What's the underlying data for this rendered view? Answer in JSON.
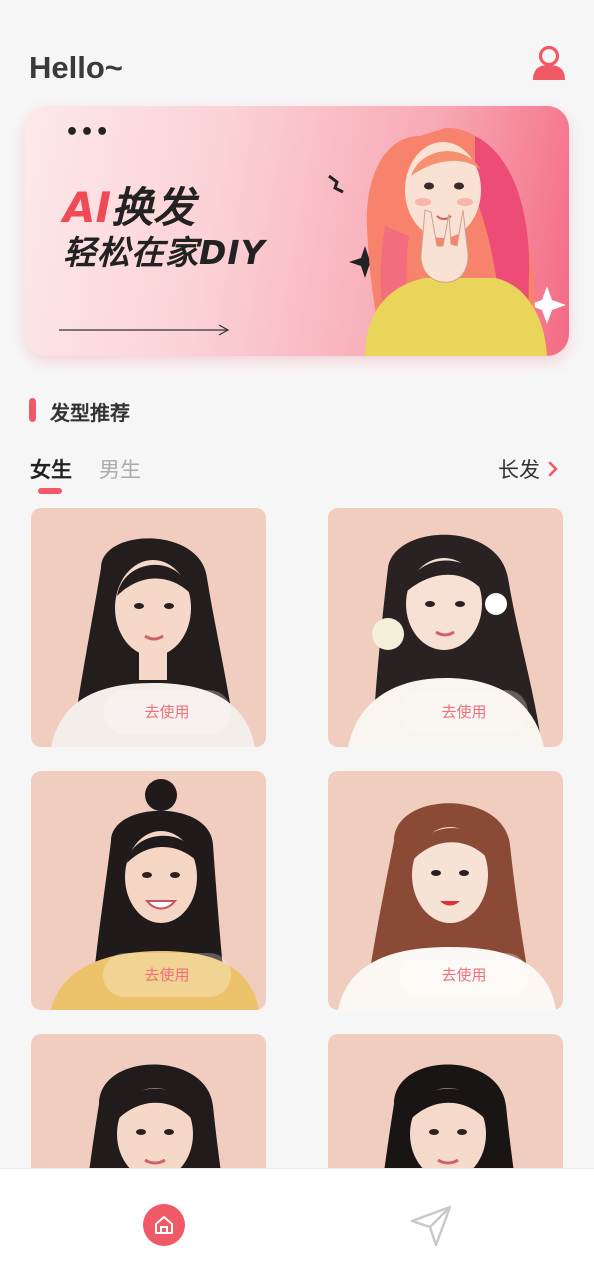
{
  "header": {
    "greeting": "Hello~",
    "user_icon": "user-icon"
  },
  "banner": {
    "dots": "•••",
    "line1_accent": "AI",
    "line1_rest": "换发",
    "line2": "轻松在家DIY"
  },
  "section": {
    "title": "发型推荐"
  },
  "tabs": [
    {
      "label": "女生",
      "active": true
    },
    {
      "label": "男生",
      "active": false
    }
  ],
  "category": {
    "label": "长发",
    "icon": "chevron-right-icon"
  },
  "cards": [
    {
      "button": "去使用"
    },
    {
      "button": "去使用"
    },
    {
      "button": "去使用"
    },
    {
      "button": "去使用"
    },
    {
      "button": ""
    },
    {
      "button": ""
    }
  ],
  "nav": {
    "home_icon": "home-icon",
    "send_icon": "send-icon"
  },
  "colors": {
    "accent": "#f05a66",
    "background": "#f6f6f7",
    "card_bg": "#f0cdbf"
  }
}
